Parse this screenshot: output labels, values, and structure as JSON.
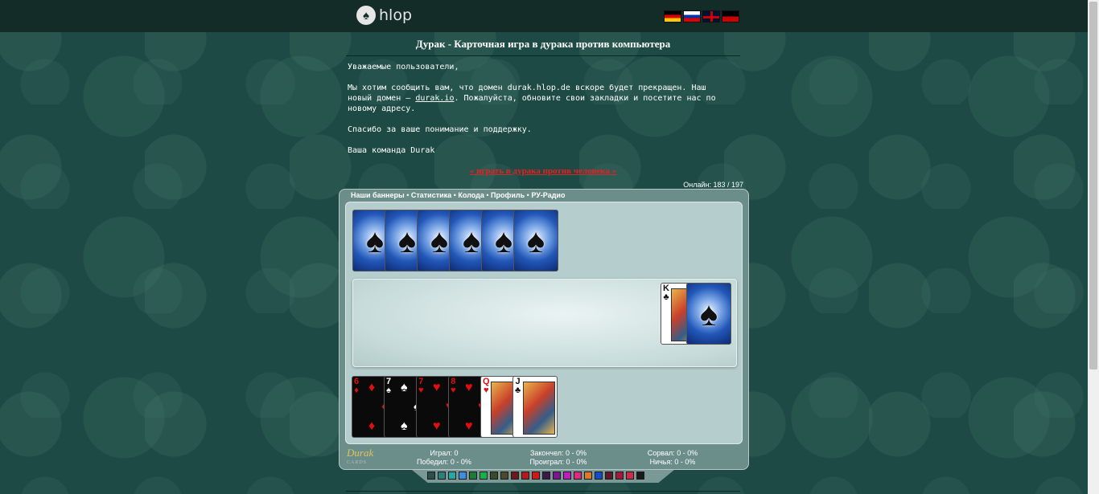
{
  "header": {
    "logo_text": "hlop",
    "flags": [
      "de",
      "ru",
      "gb",
      "dd"
    ]
  },
  "page": {
    "title": "Дурак - Карточная игра в дурака против компьютера",
    "notice": {
      "greeting": "Уважаемые пользователи,",
      "line1": "Мы хотим сообщить вам, что домен durak.hlop.de вскоре будет прекращен. Наш новый домен —",
      "domain_link": "durak.io",
      "line2": ". Пожалуйста, обновите свои закладки и посетите нас по новому адресу.",
      "thanks": "Спасибо за ваше понимание и поддержку.",
      "signature": "Ваша команда Durak"
    },
    "play_human_link": "« играть в дурака против человека »",
    "online": "Онлайн: 183 / 197"
  },
  "game": {
    "nav": [
      "Наши баннеры",
      "Статистика",
      "Колода",
      "Профиль",
      "РУ-Радио"
    ],
    "nav_sep": "•",
    "opponent_card_count": 6,
    "table": {
      "trump_card": {
        "rank": "K",
        "suit": "♣"
      },
      "deck_back": true
    },
    "player_hand": [
      {
        "rank": "6",
        "suit": "♦",
        "color": "red",
        "dark": true
      },
      {
        "rank": "7",
        "suit": "♠",
        "color": "white",
        "dark": true
      },
      {
        "rank": "7",
        "suit": "♥",
        "color": "red",
        "dark": true
      },
      {
        "rank": "8",
        "suit": "♥",
        "color": "red",
        "dark": true
      },
      {
        "rank": "Q",
        "suit": "♥",
        "color": "red",
        "dark": false
      },
      {
        "rank": "J",
        "suit": "♣",
        "color": "black",
        "dark": false
      }
    ],
    "logo": {
      "name": "Durak",
      "sub": "CARDS"
    },
    "stats": {
      "played": "Играл: 0",
      "won": "Победил: 0 - 0%",
      "finished": "Закончел: 0 - 0%",
      "lost": "Проиграл: 0 - 0%",
      "broke": "Сорвал: 0 - 0%",
      "draw": "Ничья: 0 - 0%"
    },
    "palette": [
      "#2b4f4a",
      "#2e7f7c",
      "#29a6a6",
      "#3c8fe0",
      "#1f7a3a",
      "#16b14a",
      "#3c4a2a",
      "#4a4a2a",
      "#6a1a1a",
      "#b51a1a",
      "#d01a1a",
      "#3a1a4a",
      "#7a1a8a",
      "#c01ac0",
      "#e02a80",
      "#e07a20",
      "#1a4ac0",
      "#5a1a2a",
      "#a01a3a",
      "#d02a4a",
      "#1a1a1a"
    ]
  }
}
